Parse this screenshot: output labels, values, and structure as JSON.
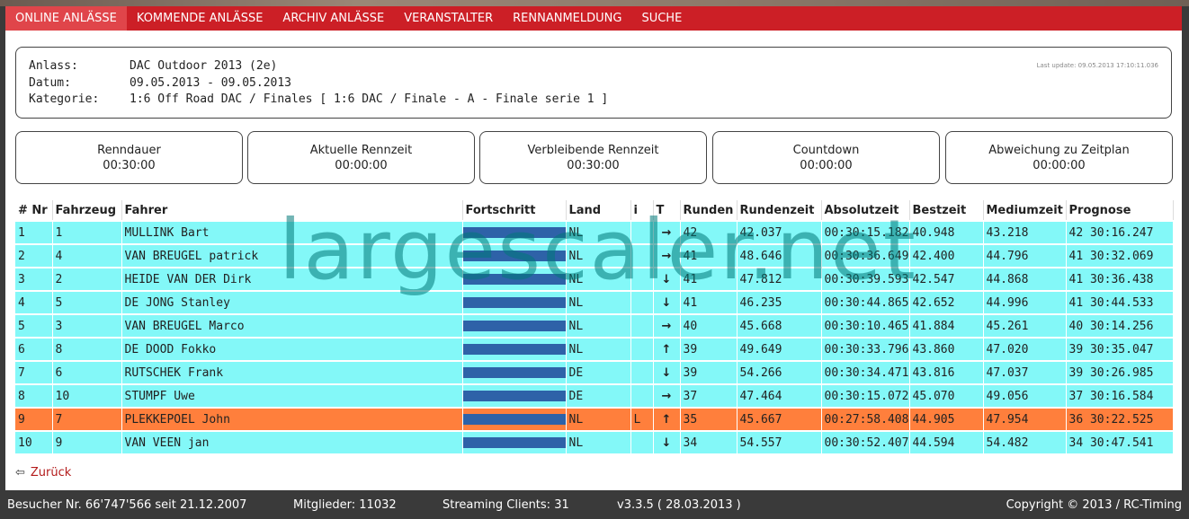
{
  "nav": {
    "items": [
      "ONLINE ANLÄSSE",
      "KOMMENDE ANLÄSSE",
      "ARCHIV ANLÄSSE",
      "VERANSTALTER",
      "RENNANMELDUNG",
      "SUCHE"
    ]
  },
  "info": {
    "anlass_label": "Anlass:",
    "anlass": "DAC Outdoor 2013 (2e)",
    "datum_label": "Datum:",
    "datum": "09.05.2013 - 09.05.2013",
    "kategorie_label": "Kategorie:",
    "kategorie": "1:6 Off Road DAC / Finales [ 1:6 DAC / Finale - A - Finale serie 1 ]",
    "last_update": "Last update: 09.05.2013 17:10:11.036"
  },
  "stats": [
    {
      "title": "Renndauer",
      "value": "00:30:00"
    },
    {
      "title": "Aktuelle Rennzeit",
      "value": "00:00:00"
    },
    {
      "title": "Verbleibende Rennzeit",
      "value": "00:30:00"
    },
    {
      "title": "Countdown",
      "value": "00:00:00"
    },
    {
      "title": "Abweichung zu Zeitplan",
      "value": "00:00:00"
    }
  ],
  "table": {
    "headers": [
      "# Nr",
      "Fahrzeug",
      "Fahrer",
      "Fortschritt",
      "Land",
      "i",
      "T",
      "Runden",
      "Rundenzeit",
      "Absolutzeit",
      "Bestzeit",
      "Mediumzeit",
      "Prognose"
    ],
    "rows": [
      {
        "nr": "1",
        "fz": "1",
        "fahrer": "MULLINK Bart",
        "progress": 1.0,
        "land": "NL",
        "i": "",
        "trend": "→",
        "runden": "42",
        "rz": "42.037",
        "abs": "00:30:15.182",
        "best": "40.948",
        "med": "43.218",
        "prog": "42 30:16.247",
        "hl": false
      },
      {
        "nr": "2",
        "fz": "4",
        "fahrer": "VAN BREUGEL patrick",
        "progress": 1.0,
        "land": "NL",
        "i": "",
        "trend": "→",
        "runden": "41",
        "rz": "48.646",
        "abs": "00:30:36.649",
        "best": "42.400",
        "med": "44.796",
        "prog": "41 30:32.069",
        "hl": false
      },
      {
        "nr": "3",
        "fz": "2",
        "fahrer": "HEIDE VAN DER Dirk",
        "progress": 1.0,
        "land": "NL",
        "i": "",
        "trend": "↓",
        "runden": "41",
        "rz": "47.812",
        "abs": "00:30:39.593",
        "best": "42.547",
        "med": "44.868",
        "prog": "41 30:36.438",
        "hl": false
      },
      {
        "nr": "4",
        "fz": "5",
        "fahrer": "DE JONG Stanley",
        "progress": 1.0,
        "land": "NL",
        "i": "",
        "trend": "↓",
        "runden": "41",
        "rz": "46.235",
        "abs": "00:30:44.865",
        "best": "42.652",
        "med": "44.996",
        "prog": "41 30:44.533",
        "hl": false
      },
      {
        "nr": "5",
        "fz": "3",
        "fahrer": "VAN BREUGEL Marco",
        "progress": 1.0,
        "land": "NL",
        "i": "",
        "trend": "→",
        "runden": "40",
        "rz": "45.668",
        "abs": "00:30:10.465",
        "best": "41.884",
        "med": "45.261",
        "prog": "40 30:14.256",
        "hl": false
      },
      {
        "nr": "6",
        "fz": "8",
        "fahrer": "DE DOOD Fokko",
        "progress": 1.0,
        "land": "NL",
        "i": "",
        "trend": "↑",
        "runden": "39",
        "rz": "49.649",
        "abs": "00:30:33.796",
        "best": "43.860",
        "med": "47.020",
        "prog": "39 30:35.047",
        "hl": false
      },
      {
        "nr": "7",
        "fz": "6",
        "fahrer": "RUTSCHEK Frank",
        "progress": 1.0,
        "land": "DE",
        "i": "",
        "trend": "↓",
        "runden": "39",
        "rz": "54.266",
        "abs": "00:30:34.471",
        "best": "43.816",
        "med": "47.037",
        "prog": "39 30:26.985",
        "hl": false
      },
      {
        "nr": "8",
        "fz": "10",
        "fahrer": "STUMPF Uwe",
        "progress": 1.0,
        "land": "DE",
        "i": "",
        "trend": "→",
        "runden": "37",
        "rz": "47.464",
        "abs": "00:30:15.072",
        "best": "45.070",
        "med": "49.056",
        "prog": "37 30:16.584",
        "hl": false
      },
      {
        "nr": "9",
        "fz": "7",
        "fahrer": "PLEKKEPOEL John",
        "progress": 1.0,
        "land": "NL",
        "i": "L",
        "trend": "↑",
        "runden": "35",
        "rz": "45.667",
        "abs": "00:27:58.408",
        "best": "44.905",
        "med": "47.954",
        "prog": "36 30:22.525",
        "hl": true
      },
      {
        "nr": "10",
        "fz": "9",
        "fahrer": "VAN VEEN jan",
        "progress": 1.0,
        "land": "NL",
        "i": "",
        "trend": "↓",
        "runden": "34",
        "rz": "54.557",
        "abs": "00:30:52.407",
        "best": "44.594",
        "med": "54.482",
        "prog": "34 30:47.541",
        "hl": false
      }
    ]
  },
  "back_label": "Zurück",
  "watermark": "largescaler.net",
  "footer": {
    "visitors": "Besucher Nr. 66'747'566 seit 21.12.2007",
    "members": "Mitglieder: 11032",
    "streaming": "Streaming Clients: 31",
    "version": "v3.3.5 ( 28.03.2013 )",
    "copyright": "Copyright © 2013 / RC-Timing"
  },
  "colors": {
    "nav": "#cc1f26",
    "row": "#83f8f8",
    "highlight": "#ff7f3c",
    "bar": "#2e62a8"
  }
}
